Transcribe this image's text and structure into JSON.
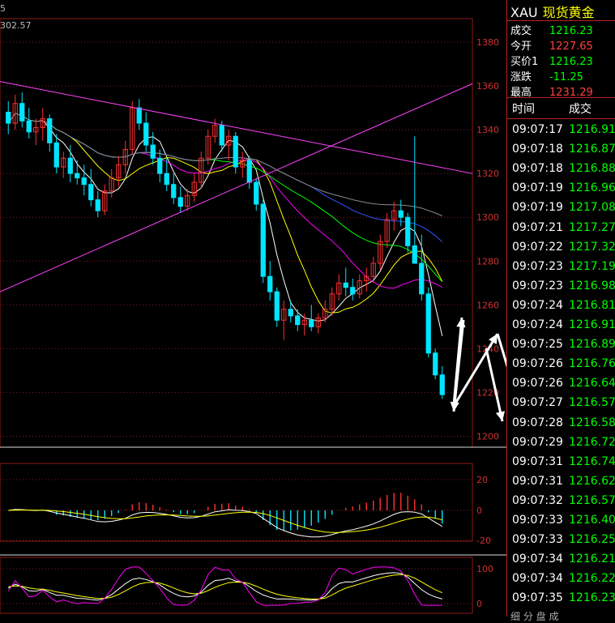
{
  "chart": {
    "title_fragment": "5",
    "top_value": "302.57",
    "price_axis_labels": [
      "1380",
      "1360",
      "1340",
      "1320",
      "1300",
      "1280",
      "1260",
      "1240",
      "1220",
      "1200"
    ],
    "macd_axis_labels": [
      "20",
      "0",
      "-20"
    ],
    "kdj_axis_labels": [
      "100",
      "0"
    ],
    "colors": {
      "up": "#ff3030",
      "down": "#00e5ff",
      "ma5": "#ffffff",
      "ma10": "#ffff00",
      "ma20": "#ff00ff",
      "ma30": "#00ff00",
      "ma60": "#3355ff",
      "ma120": "#888888",
      "trendline": "#ff44ff",
      "annotation": "#ffffff",
      "grid": "#8b1a1a",
      "axis_text": "#d03030"
    }
  },
  "chart_data": {
    "type": "candlestick",
    "ylim": [
      1195,
      1390
    ],
    "note_series": "Candlestick price chart with moving averages, MACD and KDJ sub-panels",
    "candles": [
      [
        1348,
        1353,
        1338,
        1343
      ],
      [
        1343,
        1356,
        1340,
        1352
      ],
      [
        1352,
        1357,
        1341,
        1344
      ],
      [
        1344,
        1350,
        1336,
        1339
      ],
      [
        1339,
        1345,
        1333,
        1341
      ],
      [
        1341,
        1350,
        1335,
        1345
      ],
      [
        1345,
        1347,
        1330,
        1334
      ],
      [
        1334,
        1338,
        1320,
        1323
      ],
      [
        1323,
        1330,
        1318,
        1327
      ],
      [
        1327,
        1333,
        1316,
        1320
      ],
      [
        1320,
        1326,
        1315,
        1318
      ],
      [
        1318,
        1324,
        1310,
        1315
      ],
      [
        1315,
        1322,
        1305,
        1308
      ],
      [
        1308,
        1312,
        1300,
        1303
      ],
      [
        1303,
        1315,
        1301,
        1312
      ],
      [
        1312,
        1322,
        1309,
        1318
      ],
      [
        1318,
        1328,
        1314,
        1324
      ],
      [
        1324,
        1335,
        1320,
        1331
      ],
      [
        1331,
        1353,
        1329,
        1350
      ],
      [
        1350,
        1354,
        1340,
        1343
      ],
      [
        1343,
        1348,
        1330,
        1333
      ],
      [
        1333,
        1339,
        1324,
        1327
      ],
      [
        1327,
        1331,
        1316,
        1320
      ],
      [
        1320,
        1327,
        1312,
        1315
      ],
      [
        1315,
        1320,
        1306,
        1309
      ],
      [
        1309,
        1314,
        1302,
        1305
      ],
      [
        1305,
        1313,
        1303,
        1310
      ],
      [
        1310,
        1320,
        1307,
        1316
      ],
      [
        1316,
        1330,
        1313,
        1327
      ],
      [
        1327,
        1340,
        1324,
        1337
      ],
      [
        1337,
        1345,
        1334,
        1342
      ],
      [
        1342,
        1344,
        1330,
        1333
      ],
      [
        1333,
        1340,
        1326,
        1337
      ],
      [
        1337,
        1339,
        1320,
        1323
      ],
      [
        1323,
        1330,
        1318,
        1326
      ],
      [
        1326,
        1328,
        1313,
        1316
      ],
      [
        1316,
        1318,
        1303,
        1306
      ],
      [
        1306,
        1308,
        1270,
        1273
      ],
      [
        1273,
        1280,
        1262,
        1266
      ],
      [
        1266,
        1268,
        1250,
        1253
      ],
      [
        1253,
        1262,
        1244,
        1258
      ],
      [
        1258,
        1262,
        1252,
        1255
      ],
      [
        1255,
        1258,
        1248,
        1251
      ],
      [
        1251,
        1256,
        1246,
        1253
      ],
      [
        1253,
        1260,
        1248,
        1250
      ],
      [
        1250,
        1256,
        1247,
        1254
      ],
      [
        1254,
        1262,
        1252,
        1258
      ],
      [
        1258,
        1268,
        1255,
        1265
      ],
      [
        1265,
        1274,
        1262,
        1270
      ],
      [
        1270,
        1277,
        1264,
        1268
      ],
      [
        1268,
        1272,
        1262,
        1265
      ],
      [
        1265,
        1274,
        1263,
        1271
      ],
      [
        1271,
        1277,
        1266,
        1273
      ],
      [
        1273,
        1282,
        1270,
        1279
      ],
      [
        1279,
        1292,
        1276,
        1289
      ],
      [
        1289,
        1302,
        1286,
        1299
      ],
      [
        1299,
        1307,
        1294,
        1303
      ],
      [
        1303,
        1308,
        1296,
        1300
      ],
      [
        1300,
        1302,
        1284,
        1287
      ],
      [
        1287,
        1337,
        1282,
        1279
      ],
      [
        1279,
        1292,
        1262,
        1265
      ],
      [
        1265,
        1268,
        1236,
        1238
      ],
      [
        1238,
        1240,
        1226,
        1228
      ],
      [
        1228,
        1232,
        1217,
        1219
      ]
    ]
  },
  "quote": {
    "symbol": "XAU",
    "name": "现货黄金",
    "rows": [
      {
        "label": "成交",
        "value": "1216.23",
        "color": "#00ff00"
      },
      {
        "label": "今开",
        "value": "1227.65",
        "color": "#ff4040"
      },
      {
        "label": "买价1",
        "value": "1216.23",
        "color": "#00ff00"
      },
      {
        "label": "涨跌",
        "value": "-11.25",
        "color": "#00ff00"
      },
      {
        "label": "最高",
        "value": "1231.29",
        "color": "#ff4040"
      }
    ]
  },
  "ticks": {
    "header_time": "时间",
    "header_price": "成交",
    "rows": [
      {
        "time": "09:07:17",
        "price": "1216.91"
      },
      {
        "time": "09:07:18",
        "price": "1216.87"
      },
      {
        "time": "09:07:18",
        "price": "1216.88"
      },
      {
        "time": "09:07:19",
        "price": "1216.96"
      },
      {
        "time": "09:07:19",
        "price": "1217.08"
      },
      {
        "time": "09:07:21",
        "price": "1217.27"
      },
      {
        "time": "09:07:22",
        "price": "1217.32"
      },
      {
        "time": "09:07:23",
        "price": "1217.19"
      },
      {
        "time": "09:07:23",
        "price": "1216.98"
      },
      {
        "time": "09:07:24",
        "price": "1216.81"
      },
      {
        "time": "09:07:24",
        "price": "1216.91"
      },
      {
        "time": "09:07:25",
        "price": "1216.89"
      },
      {
        "time": "09:07:26",
        "price": "1216.76"
      },
      {
        "time": "09:07:26",
        "price": "1216.64"
      },
      {
        "time": "09:07:27",
        "price": "1216.57"
      },
      {
        "time": "09:07:28",
        "price": "1216.58"
      },
      {
        "time": "09:07:29",
        "price": "1216.72"
      },
      {
        "time": "09:07:31",
        "price": "1216.74"
      },
      {
        "time": "09:07:31",
        "price": "1216.62"
      },
      {
        "time": "09:07:32",
        "price": "1216.57"
      },
      {
        "time": "09:07:33",
        "price": "1216.40"
      },
      {
        "time": "09:07:33",
        "price": "1216.25"
      },
      {
        "time": "09:07:34",
        "price": "1216.21"
      },
      {
        "time": "09:07:34",
        "price": "1216.22"
      },
      {
        "time": "09:07:35",
        "price": "1216.23"
      }
    ]
  },
  "footer_tabs": "细  分  盘  成"
}
